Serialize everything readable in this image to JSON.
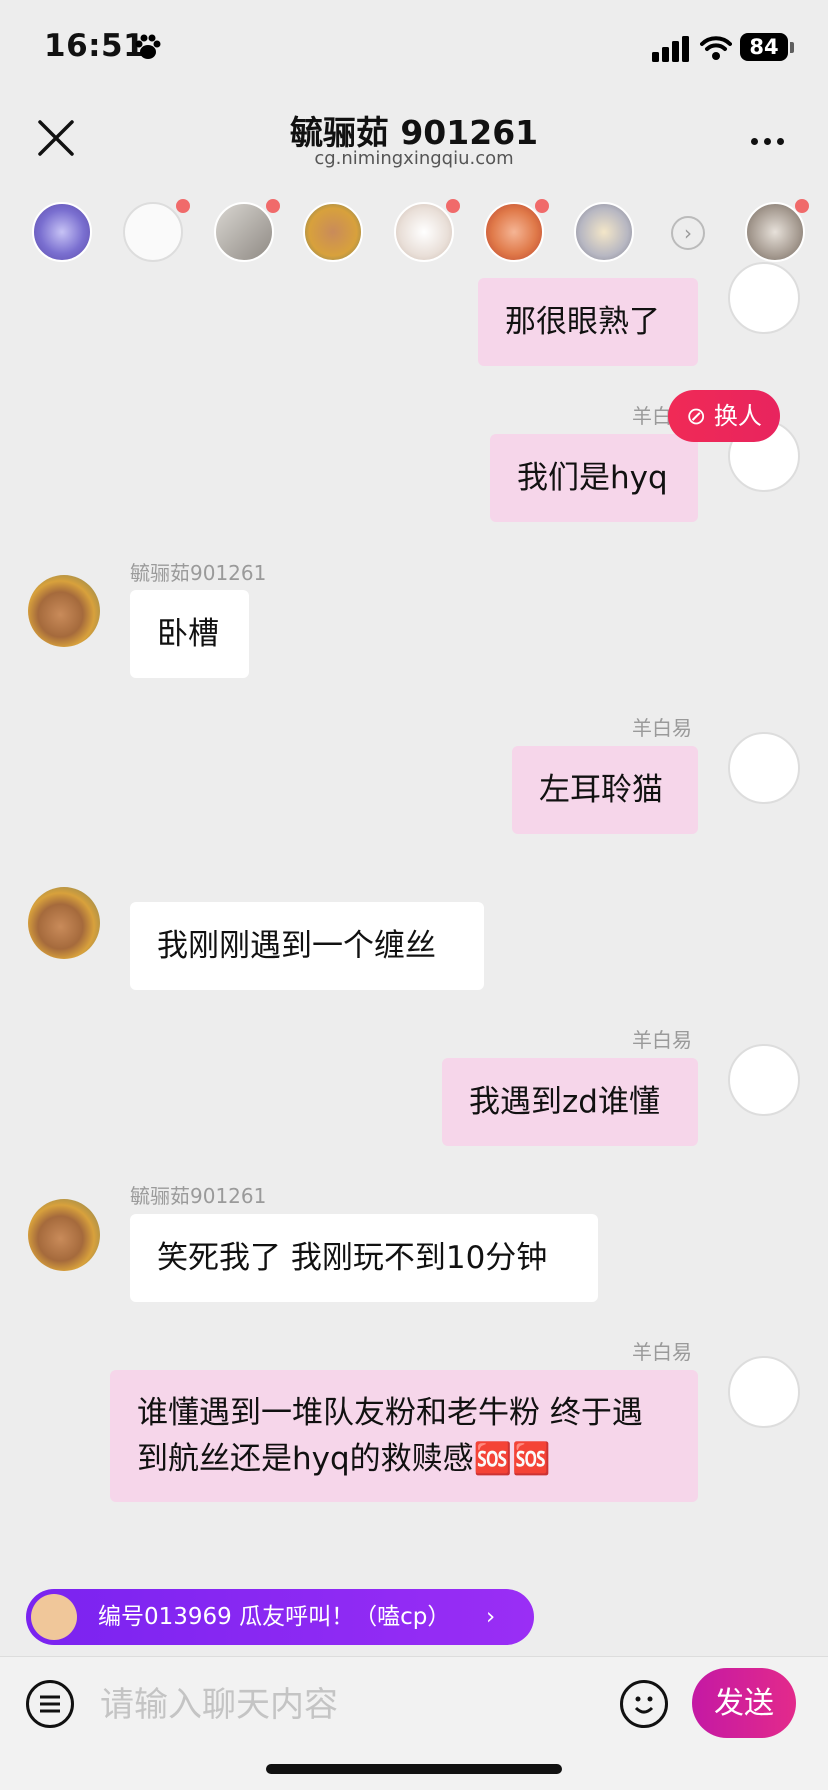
{
  "status": {
    "time": "16:51",
    "battery": "84"
  },
  "header": {
    "title": "毓骊茹 901261",
    "subtitle": "cg.nimingxingqiu.com"
  },
  "strip": {
    "next_icon": "›"
  },
  "swap": {
    "label": "换人"
  },
  "messages": [
    {
      "side": "right",
      "sender": "",
      "text": "那很眼熟了"
    },
    {
      "side": "right",
      "sender": "羊白易",
      "text": "我们是hyq"
    },
    {
      "side": "left",
      "sender": "毓骊茹901261",
      "text": "卧槽"
    },
    {
      "side": "right",
      "sender": "羊白易",
      "text": "左耳聆猫"
    },
    {
      "side": "left",
      "sender": "",
      "text": "我刚刚遇到一个缠丝"
    },
    {
      "side": "right",
      "sender": "羊白易",
      "text": "我遇到zd谁懂"
    },
    {
      "side": "left",
      "sender": "毓骊茹901261",
      "text": "笑死我了 我刚玩不到10分钟"
    },
    {
      "side": "right",
      "sender": "羊白易",
      "text": "谁懂遇到一堆队友粉和老牛粉 终于遇到航丝还是hyq的救赎感🆘🆘"
    }
  ],
  "call_banner": {
    "text": "编号013969 瓜友呼叫！（嗑cp）"
  },
  "input": {
    "placeholder": "请输入聊天内容",
    "value": ""
  },
  "send": {
    "label": "发送"
  },
  "colors": {
    "accent": "#e32a8b",
    "bubble_self": "#f6d6ea",
    "banner": "#8a28f2"
  }
}
